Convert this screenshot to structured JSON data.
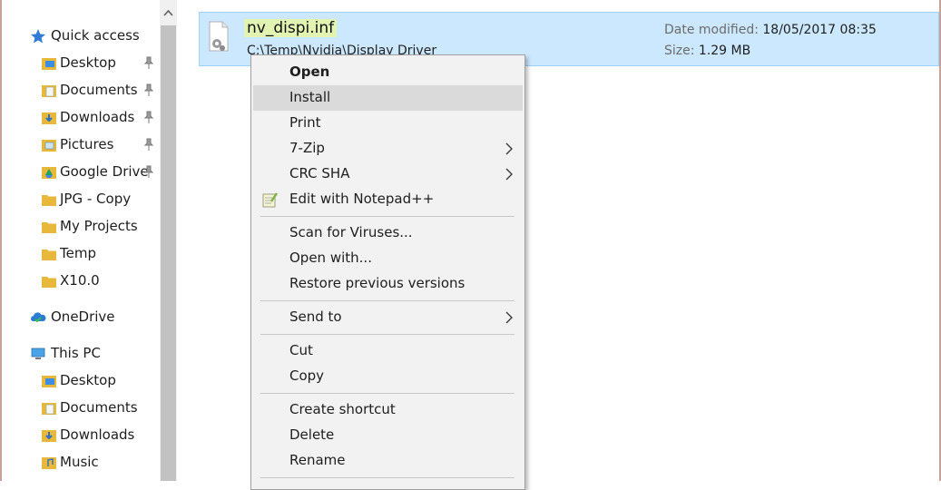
{
  "nav": {
    "quick_access": "Quick access",
    "quick_items": [
      {
        "label": "Desktop",
        "icon": "desktop-folder-icon",
        "pinned": true
      },
      {
        "label": "Documents",
        "icon": "documents-folder-icon",
        "pinned": true
      },
      {
        "label": "Downloads",
        "icon": "downloads-folder-icon",
        "pinned": true
      },
      {
        "label": "Pictures",
        "icon": "pictures-folder-icon",
        "pinned": true
      },
      {
        "label": "Google Drive",
        "icon": "google-drive-folder-icon",
        "pinned": true
      },
      {
        "label": "JPG - Copy",
        "icon": "folder-icon",
        "pinned": false
      },
      {
        "label": "My Projects",
        "icon": "folder-icon",
        "pinned": false
      },
      {
        "label": "Temp",
        "icon": "folder-icon",
        "pinned": false
      },
      {
        "label": "X10.0",
        "icon": "folder-icon",
        "pinned": false
      }
    ],
    "onedrive": "OneDrive",
    "this_pc": "This PC",
    "pc_items": [
      {
        "label": "Desktop",
        "icon": "desktop-folder-icon"
      },
      {
        "label": "Documents",
        "icon": "documents-folder-icon"
      },
      {
        "label": "Downloads",
        "icon": "downloads-folder-icon"
      },
      {
        "label": "Music",
        "icon": "music-folder-icon"
      }
    ]
  },
  "file": {
    "name": "nv_dispi.inf",
    "path": "C:\\Temp\\Nvidia\\Display Driver",
    "date_modified_label": "Date modified:",
    "date_modified_value": "18/05/2017 08:35",
    "size_label": "Size:",
    "size_value": "1.29 MB",
    "icon": "inf-file-gear-icon"
  },
  "context_menu": {
    "items": [
      {
        "label": "Open",
        "bold": true
      },
      {
        "label": "Install",
        "hover": true
      },
      {
        "label": "Print"
      },
      {
        "label": "7-Zip",
        "submenu": true
      },
      {
        "label": "CRC SHA",
        "submenu": true
      },
      {
        "label": "Edit with Notepad++",
        "icon": "notepad-plus-plus-icon"
      },
      {
        "label": "Scan for Viruses..."
      },
      {
        "label": "Open with..."
      },
      {
        "label": "Restore previous versions"
      },
      {
        "label": "Send to",
        "submenu": true
      },
      {
        "label": "Cut"
      },
      {
        "label": "Copy"
      },
      {
        "label": "Create shortcut"
      },
      {
        "label": "Delete"
      },
      {
        "label": "Rename"
      }
    ]
  },
  "colors": {
    "selection_bg": "#cce8ff",
    "selection_border": "#99d1ff",
    "name_highlight": "#e2f3b2",
    "menu_bg": "#f2f2f2",
    "menu_hover": "#dadada",
    "folder_yellow": "#e8b83a"
  }
}
